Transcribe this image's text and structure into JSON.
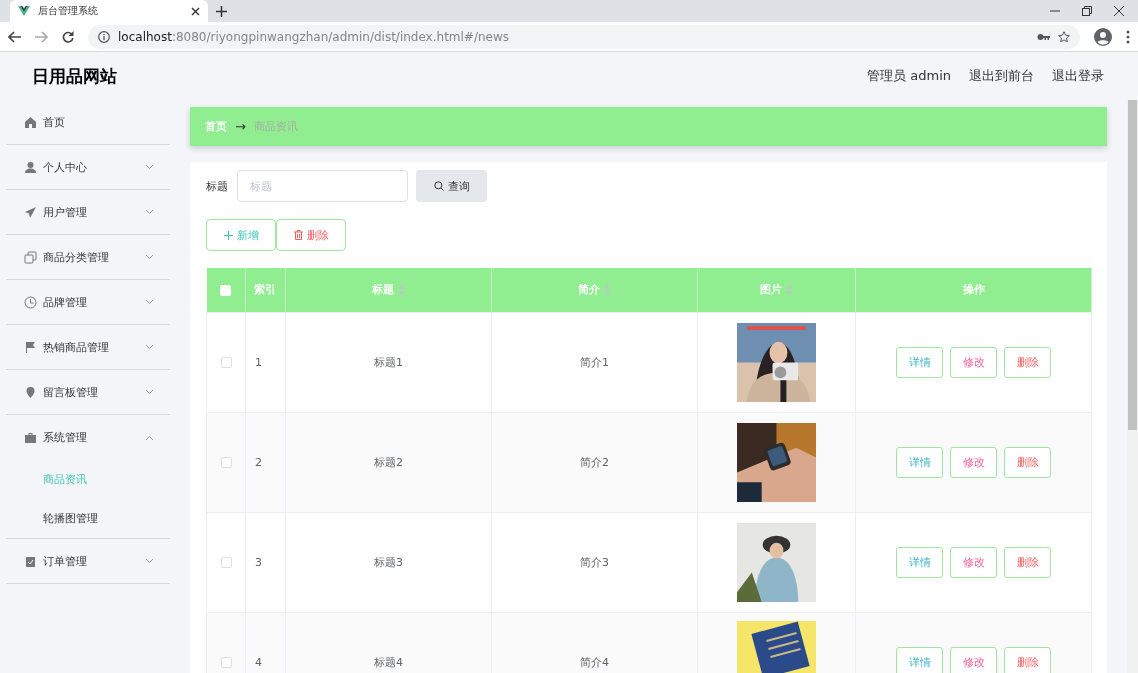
{
  "browser": {
    "tab_title": "后台管理系统",
    "url_host": "localhost",
    "url_path": ":8080/riyongpinwangzhan/admin/dist/index.html#/news"
  },
  "header": {
    "brand": "日用品网站",
    "user": "管理员 admin",
    "links": [
      "退出到前台",
      "退出登录"
    ]
  },
  "sidebar": {
    "items": [
      {
        "label": "首页"
      },
      {
        "label": "个人中心",
        "expanded": false
      },
      {
        "label": "用户管理",
        "expanded": false
      },
      {
        "label": "商品分类管理",
        "expanded": false
      },
      {
        "label": "品牌管理",
        "expanded": false
      },
      {
        "label": "热销商品管理",
        "expanded": false
      },
      {
        "label": "留言板管理",
        "expanded": false
      },
      {
        "label": "系统管理",
        "expanded": true,
        "children": [
          {
            "label": "商品资讯",
            "selected": true
          },
          {
            "label": "轮播图管理",
            "selected": false
          }
        ]
      },
      {
        "label": "订单管理",
        "expanded": false
      }
    ]
  },
  "breadcrumb": {
    "home": "首页",
    "separator": "→",
    "current": "商品资讯"
  },
  "search": {
    "label": "标题",
    "placeholder": "标题",
    "button": "查询"
  },
  "toolbar": [
    {
      "kind": "add",
      "label": "新增"
    },
    {
      "kind": "delete",
      "label": "删除"
    }
  ],
  "table": {
    "select_all": {
      "checked": false
    },
    "columns": [
      {
        "label": "索引",
        "sortable": false
      },
      {
        "label": "标题",
        "sortable": true
      },
      {
        "label": "简介",
        "sortable": true
      },
      {
        "label": "图片",
        "sortable": true
      },
      {
        "label": "操作",
        "sortable": false
      }
    ],
    "rows": [
      {
        "checked": false,
        "index": "1",
        "title": "标题1",
        "intro": "简介1",
        "picture": {
          "kind": "picture"
        },
        "actions": [
          {
            "kind": "detail",
            "label": "详情"
          },
          {
            "kind": "edit",
            "label": "修改"
          },
          {
            "kind": "delete",
            "label": "删除"
          }
        ]
      },
      {
        "checked": false,
        "index": "2",
        "title": "标题2",
        "intro": "简介2",
        "picture": {
          "kind": "picture"
        },
        "actions": [
          {
            "kind": "detail",
            "label": "详情"
          },
          {
            "kind": "edit",
            "label": "修改"
          },
          {
            "kind": "delete",
            "label": "删除"
          }
        ]
      },
      {
        "checked": false,
        "index": "3",
        "title": "标题3",
        "intro": "简介3",
        "picture": {
          "kind": "picture"
        },
        "actions": [
          {
            "kind": "detail",
            "label": "详情"
          },
          {
            "kind": "edit",
            "label": "修改"
          },
          {
            "kind": "delete",
            "label": "删除"
          }
        ]
      },
      {
        "checked": false,
        "index": "4",
        "title": "标题4",
        "intro": "简介4",
        "picture": {
          "kind": "picture"
        },
        "actions": [
          {
            "kind": "detail",
            "label": "详情"
          },
          {
            "kind": "edit",
            "label": "修改"
          },
          {
            "kind": "delete",
            "label": "删除"
          }
        ]
      }
    ]
  }
}
